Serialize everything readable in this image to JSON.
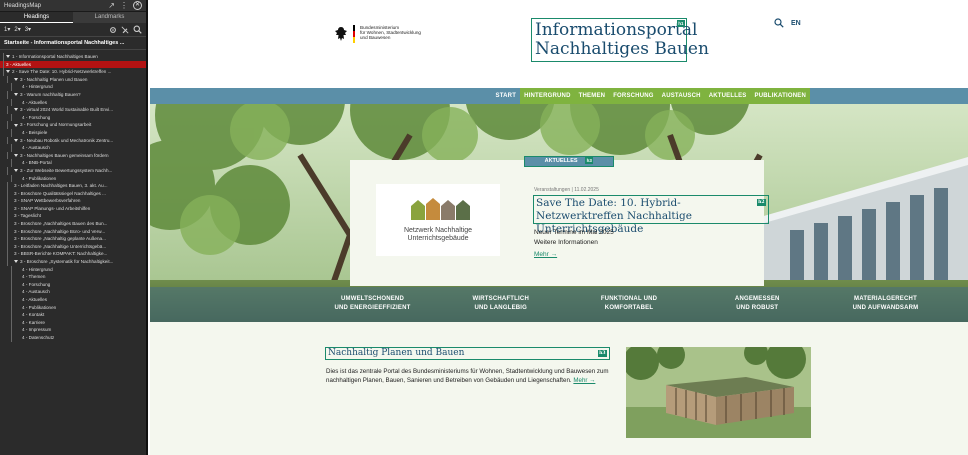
{
  "headingsmap": {
    "title": "HeadingsMap",
    "tabs": [
      "Headings",
      "Landmarks"
    ],
    "levels": [
      "1▾",
      "2▾",
      "3▾"
    ],
    "page_title": "Startseite - Informationsportal Nachhaltiges ...",
    "items": [
      {
        "level": 1,
        "text": "1 - Informationsportal Nachhaltiges Bauen",
        "expandable": true,
        "error": false
      },
      {
        "level": 1,
        "text": "3 - Aktuelles",
        "expandable": false,
        "error": true
      },
      {
        "level": 1,
        "text": "2 - Save The Date: 10. Hybrid-Netzwerktreffen ...",
        "expandable": true,
        "error": false
      },
      {
        "level": 2,
        "text": "3 - Nachhaltig Planen und Bauen",
        "expandable": true,
        "error": false
      },
      {
        "level": 3,
        "text": "4 - Hintergrund",
        "expandable": false,
        "error": false
      },
      {
        "level": 2,
        "text": "3 - Warum nachhaltig Bauen?",
        "expandable": true,
        "error": false
      },
      {
        "level": 3,
        "text": "4 - Aktuelles",
        "expandable": false,
        "error": false
      },
      {
        "level": 2,
        "text": "3 - virtual 2024 World Sustainable Built Envi...",
        "expandable": true,
        "error": false
      },
      {
        "level": 3,
        "text": "4 - Forschung",
        "expandable": false,
        "error": false
      },
      {
        "level": 2,
        "text": "3 - Forschung und Normungsarbeit",
        "expandable": true,
        "error": false
      },
      {
        "level": 3,
        "text": "4 - Beispiele",
        "expandable": false,
        "error": false
      },
      {
        "level": 2,
        "text": "3 - Neubau Robotik und Mechatronik Zentru...",
        "expandable": true,
        "error": false
      },
      {
        "level": 3,
        "text": "4 - Austausch",
        "expandable": false,
        "error": false
      },
      {
        "level": 2,
        "text": "3 - Nachhaltiges Bauen gemeinsam fördern",
        "expandable": true,
        "error": false
      },
      {
        "level": 3,
        "text": "4 - BNB-Portal",
        "expandable": false,
        "error": false
      },
      {
        "level": 2,
        "text": "3 - Zur Webseite Bewertungssystem Nachh...",
        "expandable": true,
        "error": false
      },
      {
        "level": 3,
        "text": "4 - Publikationen",
        "expandable": false,
        "error": false
      },
      {
        "level": 2,
        "text": "3 - Leitfaden Nachhaltiges Bauen, 3. akt. Au...",
        "expandable": false,
        "error": false
      },
      {
        "level": 2,
        "text": "3 - Broschüre Qualitätssiegel Nachhaltiges ...",
        "expandable": false,
        "error": false
      },
      {
        "level": 2,
        "text": "3 - SNAP Wettbewerbsverfahren",
        "expandable": false,
        "error": false
      },
      {
        "level": 2,
        "text": "3 - SNAP Planungs- und Arbeitshilfen",
        "expandable": false,
        "error": false
      },
      {
        "level": 2,
        "text": "3 - Tageslicht",
        "expandable": false,
        "error": false
      },
      {
        "level": 2,
        "text": "3 - Broschüre „Nachhaltiges Bauen des Bun...",
        "expandable": false,
        "error": false
      },
      {
        "level": 2,
        "text": "3 - Broschüre „Nachhaltige Büro- und Verw...",
        "expandable": false,
        "error": false
      },
      {
        "level": 2,
        "text": "3 - Broschüre „Nachhaltig geplante Außena...",
        "expandable": false,
        "error": false
      },
      {
        "level": 2,
        "text": "3 - Broschüre „Nachhaltige Unterrichtsgebä...",
        "expandable": false,
        "error": false
      },
      {
        "level": 2,
        "text": "3 - BBSR-Berichte KOMPAKT: Nachhaltigke...",
        "expandable": false,
        "error": false
      },
      {
        "level": 2,
        "text": "3 - Broschüre „Systematik für Nachhaltigkeit...",
        "expandable": true,
        "error": false
      },
      {
        "level": 3,
        "text": "4 - Hintergrund",
        "expandable": false,
        "error": false
      },
      {
        "level": 3,
        "text": "4 - Themen",
        "expandable": false,
        "error": false
      },
      {
        "level": 3,
        "text": "4 - Forschung",
        "expandable": false,
        "error": false
      },
      {
        "level": 3,
        "text": "4 - Austausch",
        "expandable": false,
        "error": false
      },
      {
        "level": 3,
        "text": "4 - Aktuelles",
        "expandable": false,
        "error": false
      },
      {
        "level": 3,
        "text": "4 - Publikationen",
        "expandable": false,
        "error": false
      },
      {
        "level": 3,
        "text": "4 - Kontakt",
        "expandable": false,
        "error": false
      },
      {
        "level": 3,
        "text": "4 - Karriere",
        "expandable": false,
        "error": false
      },
      {
        "level": 3,
        "text": "4 - Impressum",
        "expandable": false,
        "error": false
      },
      {
        "level": 3,
        "text": "4 - Datenschutz",
        "expandable": false,
        "error": false
      }
    ]
  },
  "header": {
    "ministry_lines": [
      "Bundesministerium",
      "für Wohnen, Stadtentwicklung",
      "und Bauwesen"
    ],
    "portal_title_line1": "Informationsportal",
    "portal_title_line2": "Nachhaltiges Bauen",
    "portal_badge": "h1",
    "lang": "EN"
  },
  "nav": {
    "start": "START",
    "items": [
      "HINTERGRUND",
      "THEMEN",
      "FORSCHUNG",
      "AUSTAUSCH",
      "AKTUELLES",
      "PUBLIKATIONEN"
    ]
  },
  "hero": {
    "section_label": "AKTUELLES",
    "section_badge": "h3",
    "logo_line1": "Netzwerk Nachhaltige",
    "logo_line2": "Unterrichtsgebäude",
    "meta": "Veranstaltungen | 11.02.2025",
    "title": "Save The Date: 10. Hybrid-Netzwerktreffen Nachhaltige Unterrichtsgebäude",
    "title_badge": "h2",
    "text1": "Neuer Termine im Mai 2025",
    "text2": "Weitere Informationen",
    "more": "Mehr →"
  },
  "features": [
    {
      "line1": "UMWELTSCHONEND",
      "line2": "UND ENERGIEEFFIZIENT"
    },
    {
      "line1": "WIRTSCHAFTLICH",
      "line2": "UND LANGLEBIG"
    },
    {
      "line1": "FUNKTIONAL UND",
      "line2": "KOMFORTABEL"
    },
    {
      "line1": "ANGEMESSEN",
      "line2": "UND ROBUST"
    },
    {
      "line1": "MATERIALGERECHT",
      "line2": "UND AUFWANDSARM"
    }
  ],
  "section": {
    "title": "Nachhaltig Planen und Bauen",
    "badge": "h3",
    "text": "Dies ist das zentrale Portal des Bundesministeriums für Wohnen, Stadtentwicklung und Bauwesen zum nachhaltigen Planen, Bauen, Sanieren und Betreiben von Gebäuden und Liegenschaften.",
    "more": "Mehr →"
  },
  "colors": {
    "accent_green": "#7fb33f",
    "nav_blue": "#5b8fa8",
    "heading_outline": "#1a8a6b",
    "error_red": "#b31212",
    "title_blue": "#1a4c6e"
  }
}
